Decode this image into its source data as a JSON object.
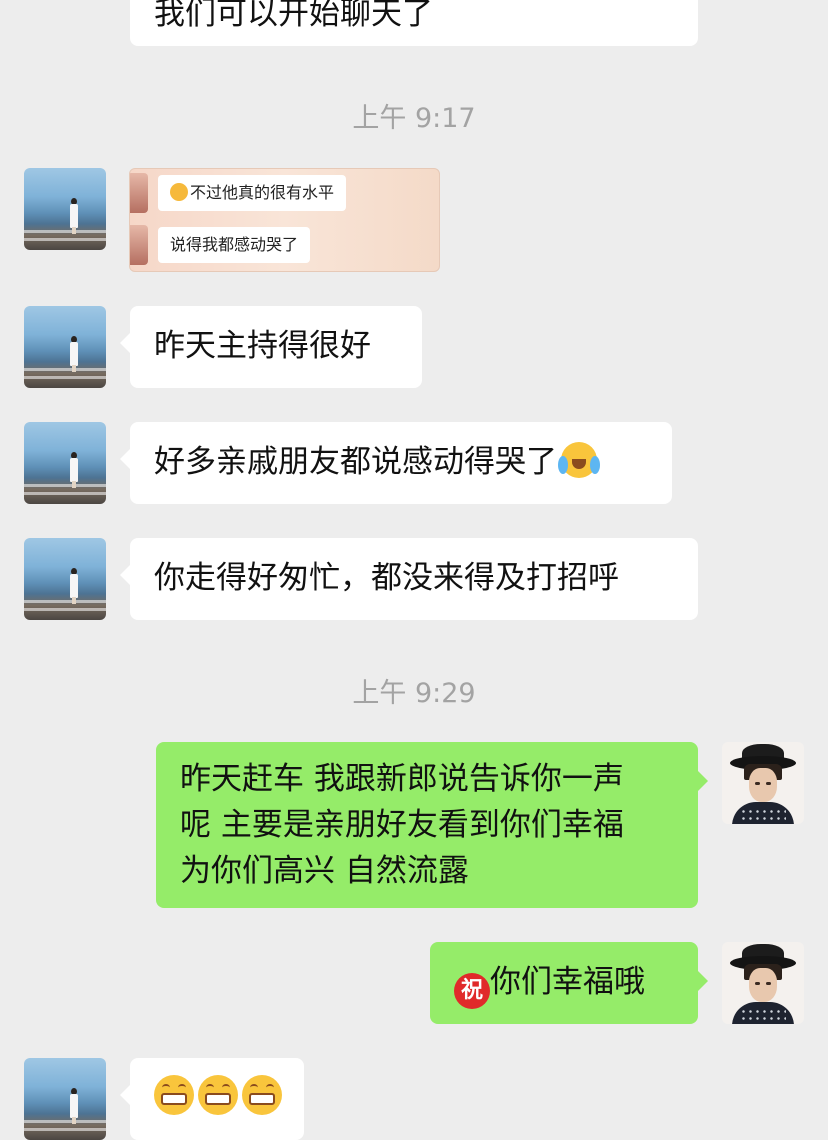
{
  "messages": {
    "top_partial": "我们可以开始聊天了",
    "time_1": "上午 9:17",
    "screenshot_line_1": "不过他真的很有水平",
    "screenshot_line_2": "说得我都感动哭了",
    "msg_1": "昨天主持得很好",
    "msg_2": "好多亲戚朋友都说感动得哭了",
    "msg_3": "你走得好匆忙，都没来得及打招呼",
    "time_2": "上午 9:29",
    "reply_line_1": "昨天赶车 我跟新郎说告诉你一声",
    "reply_line_2": "呢 主要是亲朋好友看到你们幸福",
    "reply_line_3": "为你们高兴 自然流露",
    "zhu_glyph": "祝",
    "reply_2": "你们幸福哦"
  },
  "icons": {
    "her_avatar": "beach-girl-avatar",
    "his_avatar": "man-in-hat-avatar",
    "cry_emoji": "crying-laughing-emoji",
    "grin_emoji": "grinning-teeth-emoji",
    "zhu_emoji": "zhu-blessing-emoji"
  },
  "colors": {
    "background": "#ededed",
    "incoming_bubble": "#ffffff",
    "outgoing_bubble": "#95ec69",
    "timestamp": "#a3a3a3"
  }
}
